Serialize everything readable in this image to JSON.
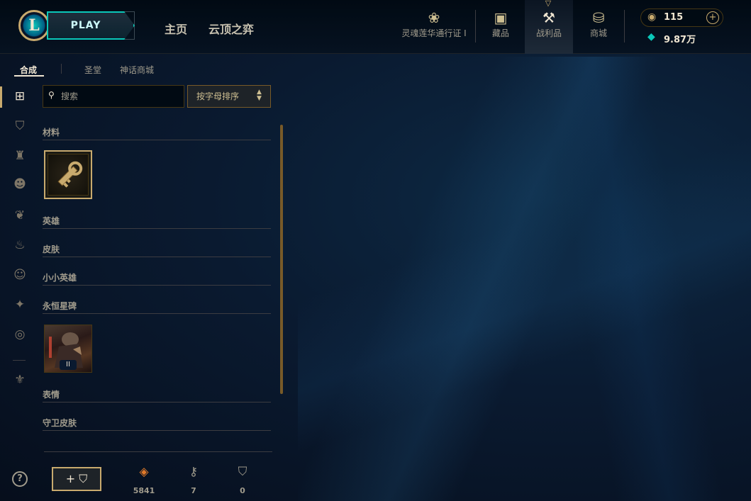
{
  "topnav": {
    "logo": "L",
    "play_label": "PLAY",
    "links": [
      "主页",
      "云顶之弈"
    ],
    "items": [
      {
        "label": "灵魂莲华通行证 I",
        "icon": "lotus-icon"
      },
      {
        "label": "藏品",
        "icon": "collection-icon"
      },
      {
        "label": "战利品",
        "icon": "loot-icon"
      },
      {
        "label": "商城",
        "icon": "store-icon"
      }
    ],
    "rp": "115",
    "blue_essence": "9.87万",
    "colors": {
      "accent": "#c8aa6e",
      "teal": "#0ac8b9"
    }
  },
  "subtabs": [
    "合成",
    "圣堂",
    "神话商城"
  ],
  "search": {
    "placeholder": "搜索"
  },
  "sort": {
    "label": "按字母排序"
  },
  "categories": [
    {
      "label": "材料"
    },
    {
      "label": "英雄"
    },
    {
      "label": "皮肤"
    },
    {
      "label": "小小英雄"
    },
    {
      "label": "永恒星碑"
    },
    {
      "label": "表情"
    },
    {
      "label": "守卫皮肤"
    }
  ],
  "items": {
    "emblem_tier": "II"
  },
  "bottom": {
    "counters": [
      {
        "icon": "orange-essence-icon",
        "value": "5841"
      },
      {
        "icon": "key-fragment-icon",
        "value": "7"
      },
      {
        "icon": "ward-icon",
        "value": "0"
      }
    ]
  }
}
